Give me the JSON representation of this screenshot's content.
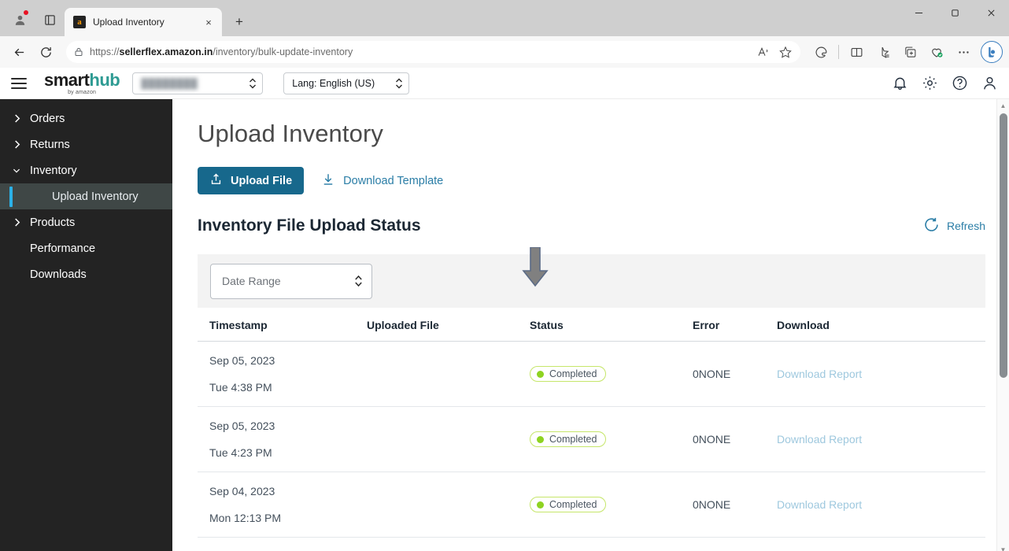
{
  "browser": {
    "tab": {
      "title": "Upload Inventory",
      "favicon": "amazon-favicon",
      "close_label": "×"
    },
    "newtab_label": "+",
    "window_controls": {
      "minimize": "─",
      "maximize": "❐",
      "close": "✕"
    },
    "url_prefix": "https://",
    "url_domain": "sellerflex.amazon.in",
    "url_path": "/inventory/bulk-update-inventory",
    "toolbar_icons": [
      "back-arrow",
      "reload",
      "lock",
      "read-aloud",
      "favorite-star",
      "browser-essentials",
      "split-screen",
      "collections",
      "add-tabs-to-collection",
      "shopping",
      "settings-more",
      "bing-copilot"
    ]
  },
  "app_header": {
    "menu_label": "hamburger-menu",
    "logo": {
      "part1": "smart",
      "part2": "hub",
      "byline": "by amazon"
    },
    "account_select_value": "████████",
    "lang_select_value": "Lang: English (US)",
    "icons": [
      "notifications-bell",
      "settings-gear",
      "help-question",
      "user-account"
    ]
  },
  "sidebar": {
    "items": [
      {
        "label": "Orders",
        "expandable": true,
        "expanded": false,
        "selected": false
      },
      {
        "label": "Returns",
        "expandable": true,
        "expanded": false,
        "selected": false
      },
      {
        "label": "Inventory",
        "expandable": true,
        "expanded": true,
        "selected": false
      },
      {
        "label": "Upload Inventory",
        "expandable": false,
        "expanded": false,
        "selected": true,
        "sub": true
      },
      {
        "label": "Products",
        "expandable": true,
        "expanded": false,
        "selected": false
      },
      {
        "label": "Performance",
        "expandable": false,
        "expanded": false,
        "selected": false
      },
      {
        "label": "Downloads",
        "expandable": false,
        "expanded": false,
        "selected": false
      }
    ]
  },
  "main": {
    "page_title": "Upload Inventory",
    "upload_button": "Upload File",
    "download_template": "Download Template",
    "section_title": "Inventory File Upload Status",
    "refresh_label": "Refresh",
    "date_range_placeholder": "Date Range",
    "table": {
      "columns": [
        "Timestamp",
        "Uploaded File",
        "Status",
        "Error",
        "Download"
      ],
      "rows": [
        {
          "date": "Sep 05, 2023",
          "time": "Tue 4:38 PM",
          "file": "",
          "status": "Completed",
          "error": "0NONE",
          "download": "Download Report"
        },
        {
          "date": "Sep 05, 2023",
          "time": "Tue 4:23 PM",
          "file": "",
          "status": "Completed",
          "error": "0NONE",
          "download": "Download Report"
        },
        {
          "date": "Sep 04, 2023",
          "time": "Mon 12:13 PM",
          "file": "",
          "status": "Completed",
          "error": "0NONE",
          "download": "Download Report"
        }
      ]
    }
  },
  "colors": {
    "accent_button": "#17688c",
    "link": "#2a7da6",
    "sidebar_bg": "#232323",
    "sidebar_selected_bg": "#3f4746",
    "sidebar_selected_bar": "#2bb1e8",
    "status_dot": "#8ed321",
    "status_border": "#c6e66a",
    "logo_teal": "#2e9b93"
  },
  "annotation": {
    "type": "down-arrow-pointer",
    "points_at": "Download Template"
  }
}
